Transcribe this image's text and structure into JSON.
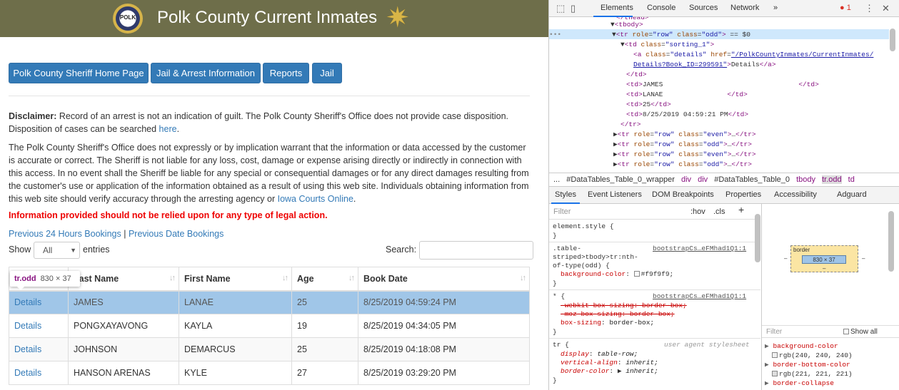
{
  "page": {
    "title": "Polk County Current Inmates",
    "logo_text": "POLK",
    "nav": [
      "Polk County Sheriff Home Page",
      "Jail & Arrest Information",
      "Reports",
      "Jail"
    ],
    "disclaimer_label": "Disclaimer:",
    "disclaimer_text": " Record of an arrest is not an indication of guilt. The Polk County Sheriff's Office does not provide case disposition. Disposition of cases can be searched ",
    "disclaimer_link": "here",
    "liability_text": "The Polk County Sheriff's Office does not expressly or by implication warrant that the information or data accessed by the customer is accurate or correct. The Sheriff is not liable for any loss, cost, damage or expense arising directly or indirectly in connection with this access. In no event shall the Sheriff be liable for any special or consequential damages or for any direct damages resulting from the customer's use or application of the information obtained as a result of using this web site. Individuals obtaining information from this web site should verify accuracy through the arresting agency or ",
    "liability_link": "Iowa Courts Online",
    "warning": "Information provided should not be relied upon for any type of legal action.",
    "link_prev24": "Previous 24 Hours Bookings",
    "link_sep": "|",
    "link_prevdate": "Previous Date Bookings",
    "show_label": "Show",
    "show_value": "All",
    "entries_label": "entries",
    "search_label": "Search:",
    "columns": [
      "Last Name",
      "First Name",
      "Age",
      "Book Date"
    ],
    "rows": [
      {
        "details": "Details",
        "last": "JAMES",
        "first": "LANAE",
        "age": "25",
        "date": "8/25/2019 04:59:24 PM"
      },
      {
        "details": "Details",
        "last": "PONGXAYAVONG",
        "first": "KAYLA",
        "age": "19",
        "date": "8/25/2019 04:34:05 PM"
      },
      {
        "details": "Details",
        "last": "JOHNSON",
        "first": "DEMARCUS",
        "age": "25",
        "date": "8/25/2019 04:18:08 PM"
      },
      {
        "details": "Details",
        "last": "HANSON ARENAS",
        "first": "KYLE",
        "age": "27",
        "date": "8/25/2019 03:29:20 PM"
      }
    ],
    "tooltip_tag": "tr.odd",
    "tooltip_size": "830 × 37"
  },
  "devtools": {
    "tabs": [
      "Elements",
      "Console",
      "Sources",
      "Network",
      "»"
    ],
    "error_count": "1",
    "breadcrumb": [
      "...",
      "#DataTables_Table_0_wrapper",
      "div",
      "div",
      "#DataTables_Table_0",
      "tbody",
      "tr.odd",
      "td"
    ],
    "subtabs": [
      "Styles",
      "Event Listeners",
      "DOM Breakpoints",
      "Properties",
      "Accessibility",
      "Adguard"
    ],
    "filter_placeholder": "Filter",
    "hov": ":hov",
    "cls": ".cls",
    "plus": "+",
    "box_label": "border",
    "box_dash": "–",
    "box_size": "830 × 37",
    "computed_filter": "Filter",
    "show_all": "Show all",
    "colors": {
      "selected_row": "#6fa8dc",
      "accent": "#1a73e8"
    }
  }
}
